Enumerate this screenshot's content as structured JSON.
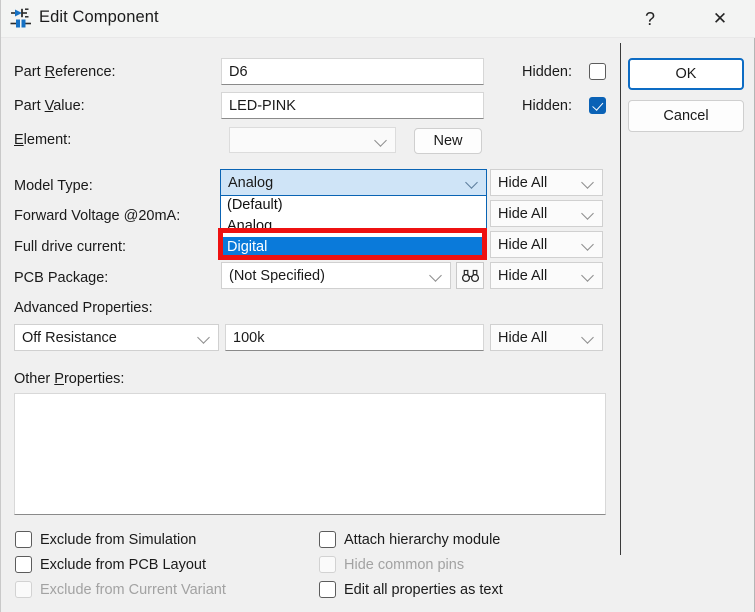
{
  "window": {
    "title": "Edit Component",
    "icon": "component-diode-icon",
    "help_label": "?",
    "close_label": "✕"
  },
  "form": {
    "part_reference": {
      "label_pre": "Part ",
      "label_mnemonic": "R",
      "label_post": "eference:",
      "value": "D6",
      "hidden_label": "Hidden:",
      "hidden_checked": false
    },
    "part_value": {
      "label_pre": "Part ",
      "label_mnemonic": "V",
      "label_post": "alue:",
      "value": "LED-PINK",
      "hidden_label": "Hidden:",
      "hidden_checked": true
    },
    "element": {
      "label_mnemonic": "E",
      "label_post": "lement:",
      "value": "",
      "new_button": "New"
    },
    "model_type": {
      "label": "Model Type:",
      "value": "Analog",
      "options": [
        "(Default)",
        "Analog",
        "Digital"
      ],
      "highlighted_option": "Digital",
      "hide_mode": "Hide All",
      "expanded": true
    },
    "forward_voltage": {
      "label": "Forward Voltage @20mA:",
      "value": "",
      "hide_mode": "Hide All"
    },
    "full_drive_current": {
      "label": "Full drive current:",
      "value": "",
      "hide_mode": "Hide All"
    },
    "pcb_package": {
      "label": "PCB Package:",
      "value": "(Not Specified)",
      "browse_icon": "binoculars-icon",
      "hide_mode": "Hide All"
    },
    "advanced_properties": {
      "label": "Advanced Properties:",
      "property_name": "Off Resistance",
      "property_value": "100k",
      "hide_mode": "Hide All"
    },
    "other_properties": {
      "label_pre": "Other ",
      "label_mnemonic": "P",
      "label_post": "roperties:",
      "value": ""
    }
  },
  "buttons": {
    "ok": "OK",
    "cancel": "Cancel"
  },
  "options_left": [
    {
      "label": "Exclude from Simulation",
      "checked": false,
      "disabled": false
    },
    {
      "label": "Exclude from PCB Layout",
      "checked": false,
      "disabled": false
    },
    {
      "label": "Exclude from Current Variant",
      "checked": false,
      "disabled": true
    }
  ],
  "options_right": [
    {
      "label": "Attach hierarchy module",
      "checked": false,
      "disabled": false
    },
    {
      "label": "Hide common pins",
      "checked": false,
      "disabled": true
    },
    {
      "label": "Edit all properties as text",
      "checked": false,
      "disabled": false
    }
  ],
  "colors": {
    "dialog_bg": "#f0f0f0",
    "accent_blue": "#0a62b6",
    "selection_blue": "#0a7ada",
    "combo_open_bg": "#cfe4f7",
    "annotation_red": "#ee1111",
    "disabled_text": "#a2a2a2"
  }
}
